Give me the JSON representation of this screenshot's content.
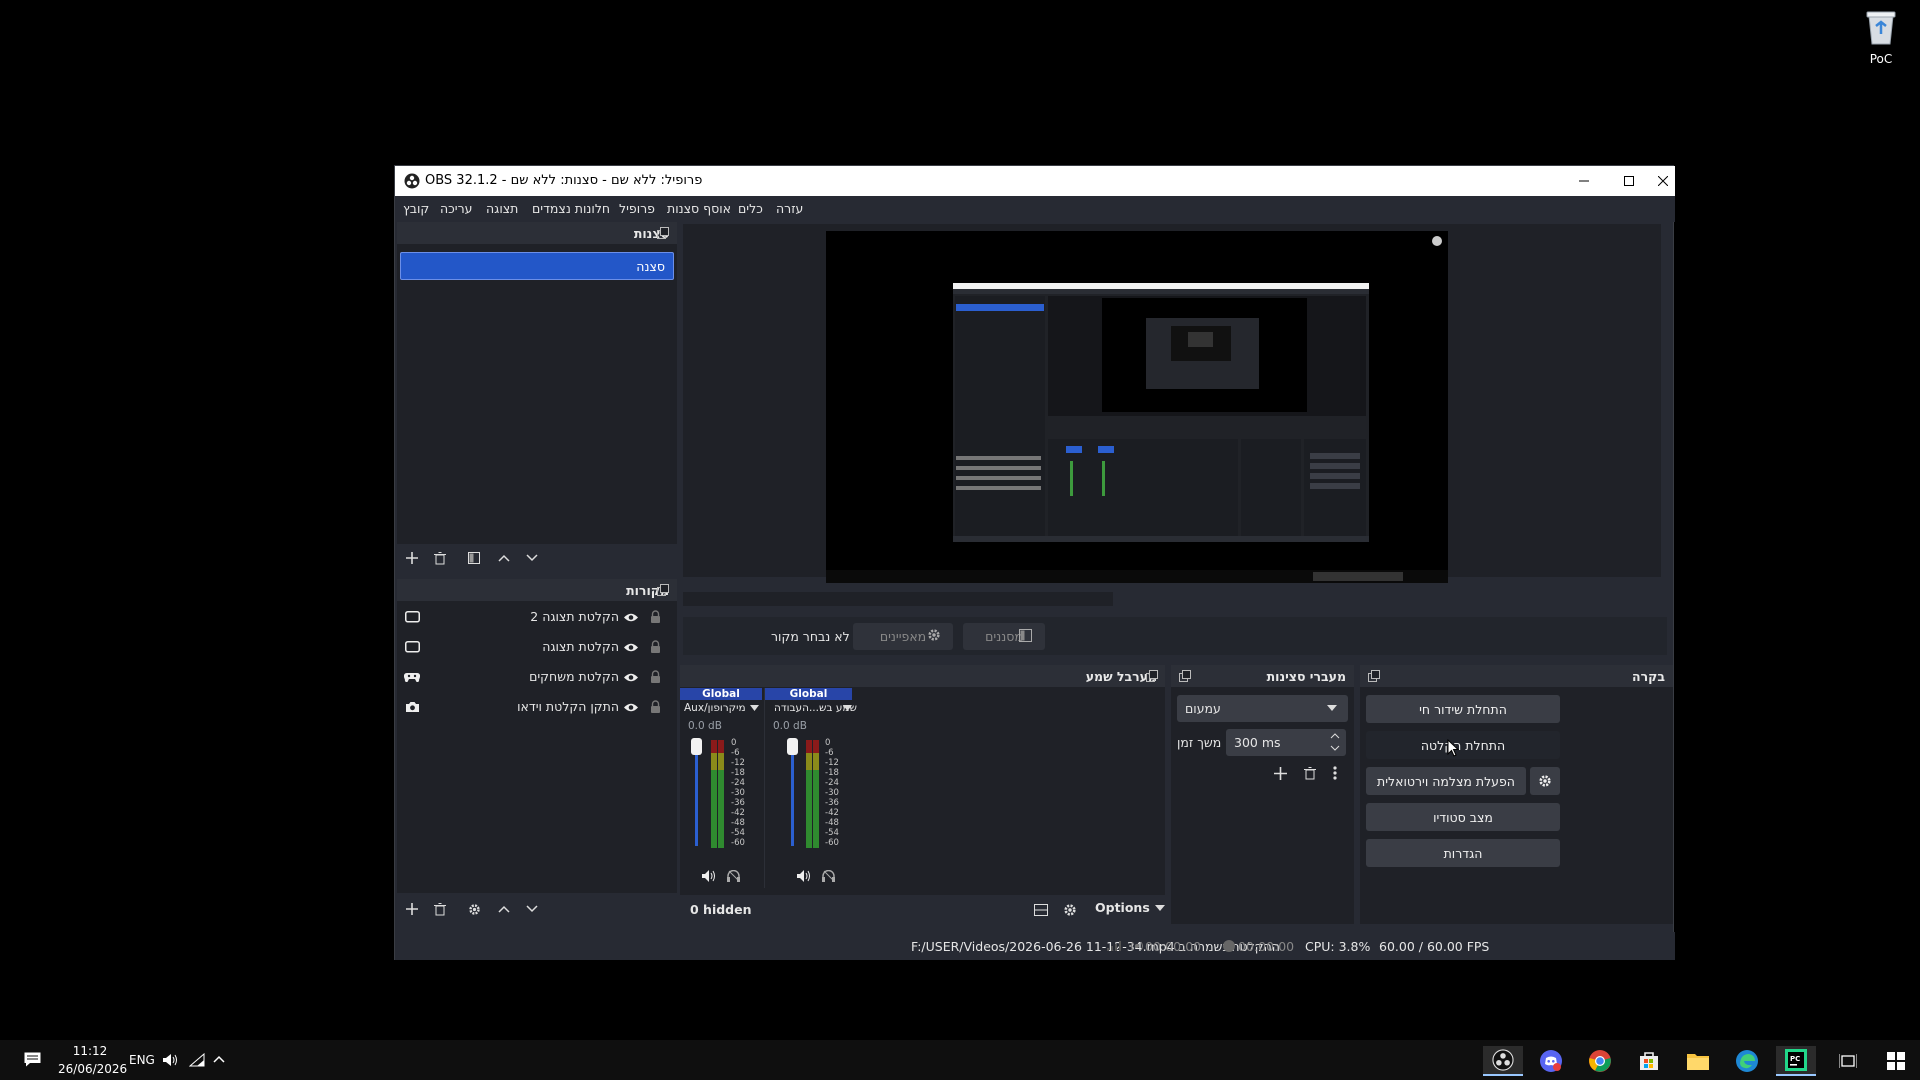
{
  "desktop": {
    "recycle_bin_label": "PoC"
  },
  "window": {
    "title": "OBS 32.1.2 - פרופיל: ללא שם - סצנות: ללא שם",
    "menu": [
      "קובץ",
      "עריכה",
      "תצוגה",
      "חלונות נצמדים",
      "פרופיל",
      "אוסף סצנות",
      "כלים",
      "עזרה"
    ]
  },
  "scenes": {
    "title": "סצנות",
    "items": [
      "סצנה"
    ]
  },
  "sources": {
    "title": "מקורות",
    "items": [
      {
        "name": "הקלטת תצוגה 2",
        "icon": "monitor-icon"
      },
      {
        "name": "הקלטת תצוגה",
        "icon": "monitor-icon"
      },
      {
        "name": "הקלטת משחקים",
        "icon": "gamepad-icon"
      },
      {
        "name": "התקן הקלטת וידאו",
        "icon": "camera-icon"
      }
    ]
  },
  "preview": {
    "source_label": "לא נבחר מקור",
    "properties_label": "מאפיינים",
    "filters_label": "מסננים"
  },
  "mixer": {
    "title": "מערבל שמע",
    "channels": [
      {
        "tag": "Global",
        "name": "מיקרופון/Aux",
        "db": "0.0 dB"
      },
      {
        "tag": "Global",
        "name": "שמע בש...העבודה",
        "db": "0.0 dB"
      }
    ],
    "ticks": [
      "0",
      "-6",
      "-12",
      "-18",
      "-24",
      "-30",
      "-36",
      "-42",
      "-48",
      "-54",
      "-60"
    ],
    "hidden_label": "0 hidden",
    "options_label": "Options"
  },
  "transitions": {
    "title": "מעברי סצינות",
    "selected": "עמעום",
    "duration_label": "משך זמן",
    "duration_value": "300 ms"
  },
  "controls": {
    "title": "בקרה",
    "buttons": [
      "התחלת שידור חי",
      "התחלת הקלטה",
      "הפעלת מצלמה וירטואלית",
      "מצב סטודיו",
      "הגדרות"
    ]
  },
  "status": {
    "saved_path": "ההקלטה נשמרה ב F:/USER/Videos/2026-06-26 11-12-34.mp4",
    "stream_time": "00:00:00",
    "record_time": "00:00:00",
    "cpu": "CPU: 3.8%",
    "fps": "60.00 / 60.00 FPS"
  },
  "taskbar": {
    "time": "11:12",
    "date": "26/06/2026",
    "lang": "ENG"
  }
}
